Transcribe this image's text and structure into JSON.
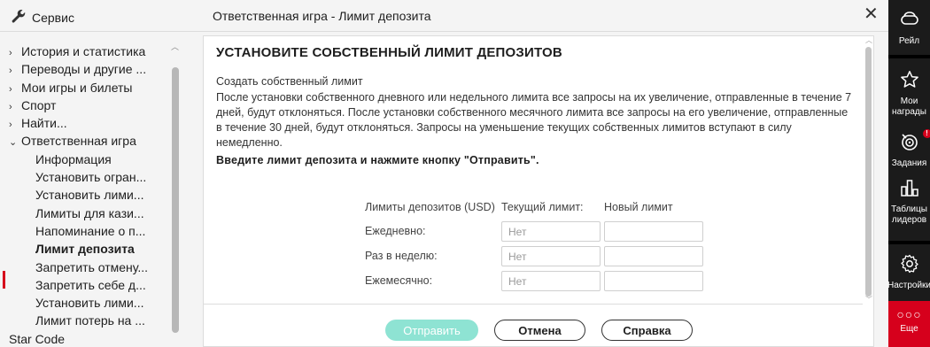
{
  "header": {
    "service_label": "Сервис",
    "window_title": "Ответственная игра - Лимит депозита",
    "close_glyph": "✕"
  },
  "sidebar": {
    "items": [
      {
        "label": "История и статистика",
        "level": 0,
        "chevron": "›"
      },
      {
        "label": "Переводы и другие ...",
        "level": 0,
        "chevron": "›"
      },
      {
        "label": "Мои игры и билеты",
        "level": 0,
        "chevron": "›"
      },
      {
        "label": "Спорт",
        "level": 0,
        "chevron": "›"
      },
      {
        "label": "Найти...",
        "level": 0,
        "chevron": "›"
      },
      {
        "label": "Ответственная игра",
        "level": 0,
        "chevron": "⌄"
      },
      {
        "label": "Информация",
        "level": 1
      },
      {
        "label": "Установить огран...",
        "level": 1
      },
      {
        "label": "Установить лими...",
        "level": 1
      },
      {
        "label": "Лимиты для кази...",
        "level": 1
      },
      {
        "label": "Напоминание о п...",
        "level": 1
      },
      {
        "label": "Лимит депозита",
        "level": 1,
        "active": true
      },
      {
        "label": "Запретить отмену...",
        "level": 1
      },
      {
        "label": "Запретить себе д...",
        "level": 1
      },
      {
        "label": "Установить лими...",
        "level": 1
      },
      {
        "label": "Лимит потерь на ...",
        "level": 1
      },
      {
        "label": "Star Code",
        "level": 0
      }
    ]
  },
  "main": {
    "heading": "УСТАНОВИТЕ СОБСТВЕННЫЙ ЛИМИТ ДЕПОЗИТОВ",
    "subheading": "Создать собственный лимит",
    "description": "После установки собственного дневного или недельного лимита все запросы на их увеличение, отправленные в течение 7 дней, будут отклоняться. После установки собственного месячного лимита все запросы на его увеличение, отправленные в течение 30 дней, будут отклоняться. Запросы на уменьшение текущих собственных лимитов вступают в силу немедленно.",
    "instruction": "Введите лимит депозита и нажмите кнопку \"Отправить\".",
    "limits": {
      "col_label": "Лимиты депозитов (USD)",
      "col_current": "Текущий лимит:",
      "col_new": "Новый лимит",
      "rows": [
        {
          "label": "Ежедневно:",
          "current": "Нет",
          "new": ""
        },
        {
          "label": "Раз в неделю:",
          "current": "Нет",
          "new": ""
        },
        {
          "label": "Ежемесячно:",
          "current": "Нет",
          "new": ""
        }
      ]
    },
    "buttons": {
      "send": "Отправить",
      "cancel": "Отмена",
      "help": "Справка"
    }
  },
  "rail": {
    "items": [
      {
        "label": "Рейл",
        "icon": "rail-icon"
      },
      {
        "label": "Мои награды",
        "icon": "star-icon"
      },
      {
        "label": "Задания",
        "icon": "target-icon",
        "badge": "!"
      },
      {
        "label": "Таблицы лидеров",
        "icon": "leaderboard-icon"
      },
      {
        "label": "Настройки",
        "icon": "gear-icon"
      }
    ],
    "more_label": "Еще",
    "more_dots": "○○○"
  },
  "colors": {
    "accent_red": "#d6001c",
    "send_button": "#8ee3d3",
    "rail_bg": "#1b1b1b"
  }
}
